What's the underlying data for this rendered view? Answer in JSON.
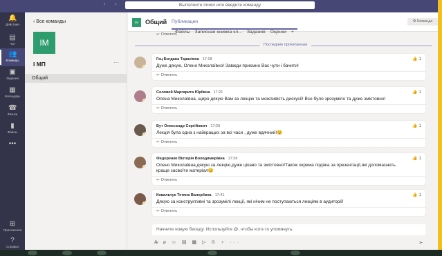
{
  "titlebar": {
    "search_placeholder": "Выполните поиск или введите команду",
    "nav_arrows": "‹ ›"
  },
  "rail": {
    "items": [
      {
        "label": "Действия",
        "icon": "bell-icon",
        "glyph": "🔔"
      },
      {
        "label": "Чат",
        "icon": "chat-icon",
        "glyph": "▤"
      },
      {
        "label": "Команды",
        "icon": "teams-icon",
        "glyph": "👥"
      },
      {
        "label": "Задания",
        "icon": "assignments-icon",
        "glyph": "▣"
      },
      {
        "label": "Календарь",
        "icon": "calendar-icon",
        "glyph": "▦"
      },
      {
        "label": "Звонки",
        "icon": "phone-icon",
        "glyph": "☎"
      },
      {
        "label": "Файлы",
        "icon": "files-icon",
        "glyph": "▮"
      },
      {
        "label": "",
        "icon": "more-icon",
        "glyph": "•••"
      }
    ],
    "bottom": [
      {
        "label": "Приложения",
        "icon": "apps-icon",
        "glyph": "⊞"
      },
      {
        "label": "Справка",
        "icon": "help-icon",
        "glyph": "?"
      }
    ]
  },
  "teampane": {
    "back_label": "‹  Все команды",
    "avatar_text": "IM",
    "team_name": "І МП",
    "more": "···",
    "channel": "Общий"
  },
  "header": {
    "avatar_text": "IM",
    "title": "Общий",
    "tabs": [
      "Публикации",
      "Файлы",
      "Записная книжка кл...",
      "Задания",
      "Оценки",
      "+"
    ],
    "team_button": "⚙ Команда"
  },
  "reply_label": "Ответить",
  "divider_label": "Последние прочитанные",
  "messages": [
    {
      "author": "Гец Богдана Тарасівна",
      "time": "17:18",
      "text": "Дуже дякую, Олено Миколаївно! Завжди приємно Вас чути і бачити!",
      "likes": "1"
    },
    {
      "author": "Соловей Маргарита Юріївна",
      "time": "17:21",
      "text": "Олена Миколаївна, щиро дякую Вам за лекцію та можливість дискусії! Все було зрозуміло та дуже змістовно!",
      "likes": "1"
    },
    {
      "author": "Бут Олександр Сергійович",
      "time": "17:29",
      "text": "Лекція була одна з найкращих за всі часи , дуже вдячний!😊",
      "likes": "1"
    },
    {
      "author": "Федоренко Вікторія Володимирівна",
      "time": "17:36",
      "text": "Олено Миколаївна,дякую за лекцію,дуже цікаво та змістовно!Також окрема подяка за презентації,які допомагають краще засвоїти матеріал😊",
      "likes": "1"
    },
    {
      "author": "Ковальчук Тетяна Валеріївна",
      "time": "17:41",
      "text": "Дякую за конструктивні та зрозумілі лекції, які нічим не поступаються лекціям в аудиторії!",
      "likes": "1"
    }
  ],
  "compose_placeholder": "Начните новую беседу. Используйте @, чтобы кого-то упомянуть.",
  "toolbar_glyphs": "A̷ ⌀ ☺ ▤ ▦ ▷ ⊙ ♀ ···",
  "send_glyph": "➢",
  "colors": {
    "accent": "#6264a7",
    "rail": "#33344a",
    "titlebar": "#464775",
    "team": "#2f9c6e",
    "like": "#f2b100",
    "frame_border": "#f0c020"
  }
}
